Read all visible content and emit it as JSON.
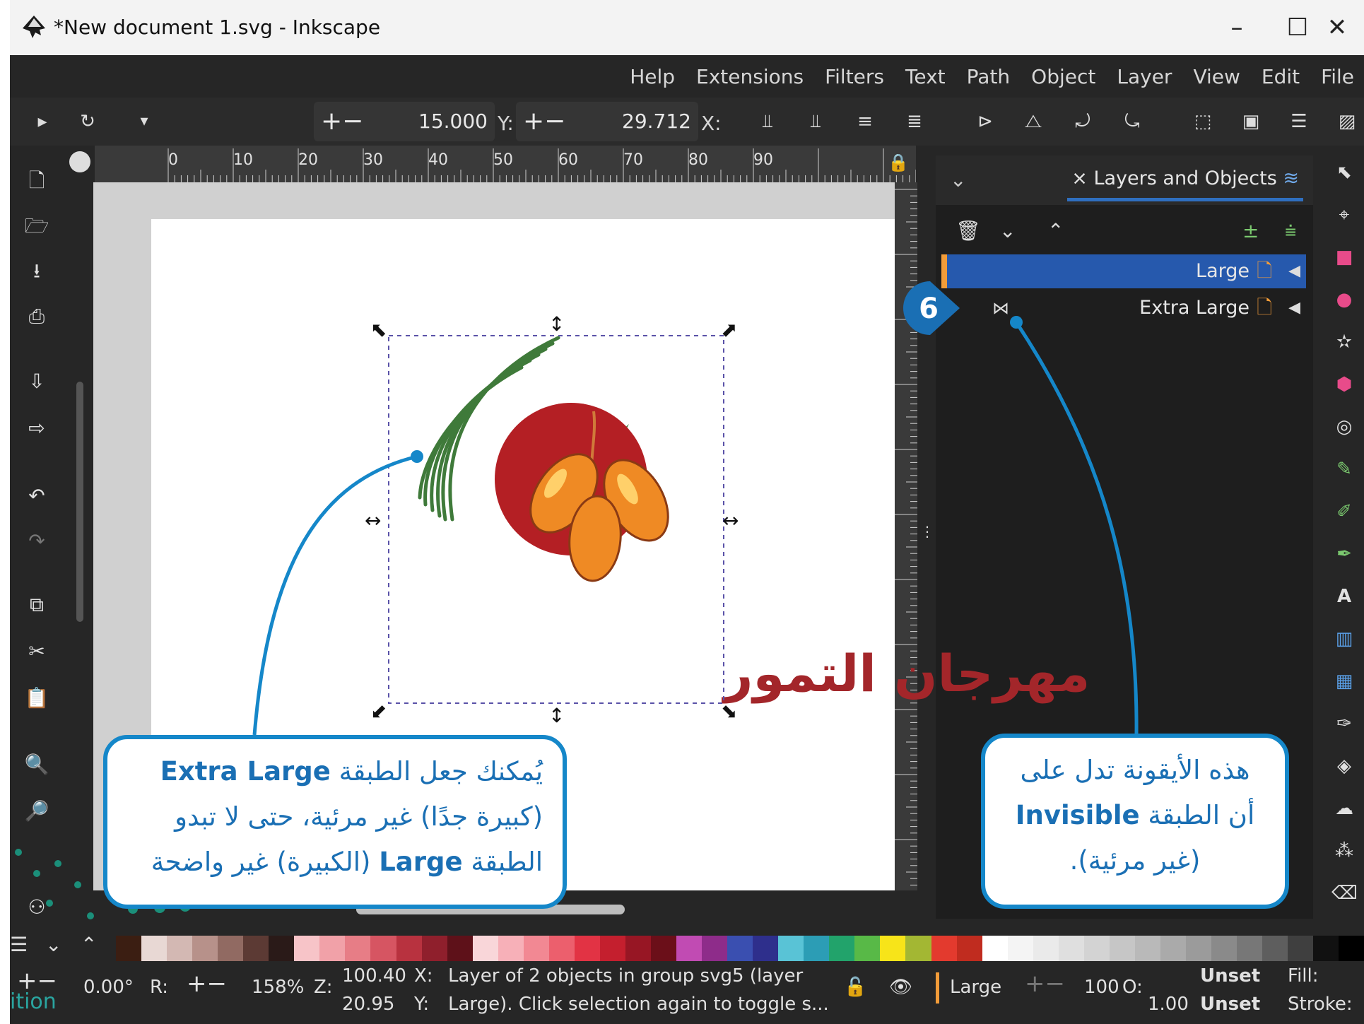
{
  "window": {
    "title": "*New document 1.svg - Inkscape",
    "controls": {
      "minimize": "–",
      "maximize": "☐",
      "close": "✕"
    }
  },
  "menu": [
    "File",
    "Edit",
    "View",
    "Layer",
    "Object",
    "Path",
    "Text",
    "Filters",
    "Extensions",
    "Help"
  ],
  "toolbar": {
    "x_label": "X:",
    "x_value": "29.712",
    "y_label": "Y:",
    "y_value": "15.000",
    "stepper": "+−"
  },
  "ruler": {
    "ticks": [
      "0",
      "10",
      "20",
      "30",
      "40",
      "50",
      "60",
      "70",
      "80",
      "90"
    ]
  },
  "canvas": {
    "logo_text": "مهرجان التمور"
  },
  "panel": {
    "tab_label": "Layers and Objects",
    "layers": [
      {
        "name": "Large",
        "selected": true
      },
      {
        "name": "Extra Large",
        "selected": false,
        "visibility": "hidden"
      }
    ]
  },
  "callouts": {
    "badge_number": "6",
    "left": {
      "line1_prefix": "يُمكنك جعل الطبقة ",
      "line1_bold": "Extra Large",
      "line2": "(كبيرة جدًا) غير مرئية، حتى لا تبدو",
      "line3_prefix": "الطبقة ",
      "line3_bold": "Large",
      "line3_suffix": " (الكبيرة) غير واضحة"
    },
    "right": {
      "line1": "هذه الأيقونة تدل على",
      "line2_prefix": "أن الطبقة ",
      "line2_bold": "Invisible",
      "line3": "(غير مرئية)."
    }
  },
  "status": {
    "rotation": "0.00°",
    "rotation_label": "R:",
    "zoom": "158%",
    "zoom_label": "Z:",
    "coord_x": "100.40",
    "coord_y": "20.95",
    "coord_x_label": "X:",
    "coord_y_label": "Y:",
    "message_line1": "Layer of 2 objects in group svg5 (layer",
    "message_line2": "Large). Click selection again to toggle s...",
    "layer_name": "Large",
    "opacity": "100",
    "opacity_label": "O:",
    "stroke_width": "1.00",
    "fill_value": "Unset",
    "stroke_value": "Unset",
    "fill_label": "Fill:",
    "stroke_label": "Stroke:",
    "watermark_left": "ition"
  },
  "palette": [
    "#3b1e12",
    "#e8d8d4",
    "#d3b8b3",
    "#b7918a",
    "#916a62",
    "#5c3a34",
    "#2a1a18",
    "#f7c4c8",
    "#f1a1a8",
    "#e77d86",
    "#d65562",
    "#b8323f",
    "#8f1f2c",
    "#5e1119",
    "#f9d6d9",
    "#f7b0b8",
    "#f28893",
    "#ec5f6d",
    "#e23344",
    "#c41f2e",
    "#971624",
    "#6b0f19",
    "#c14bb3",
    "#8e2c8a",
    "#3a4fb0",
    "#2e2f8c",
    "#59c3d6",
    "#2c9db5",
    "#22a36b",
    "#58b947",
    "#f7e419",
    "#a3b733",
    "#e33a2e",
    "#c02c1f",
    "#ffffff",
    "#f4f4f4",
    "#eaeaea",
    "#dfdfdf",
    "#d3d3d3",
    "#c6c6c6",
    "#b9b9b9",
    "#aaaaaa",
    "#9b9b9b",
    "#8a8a8a",
    "#777777",
    "#5e5e5e",
    "#3f3f3f",
    "#111111",
    "#000000"
  ]
}
